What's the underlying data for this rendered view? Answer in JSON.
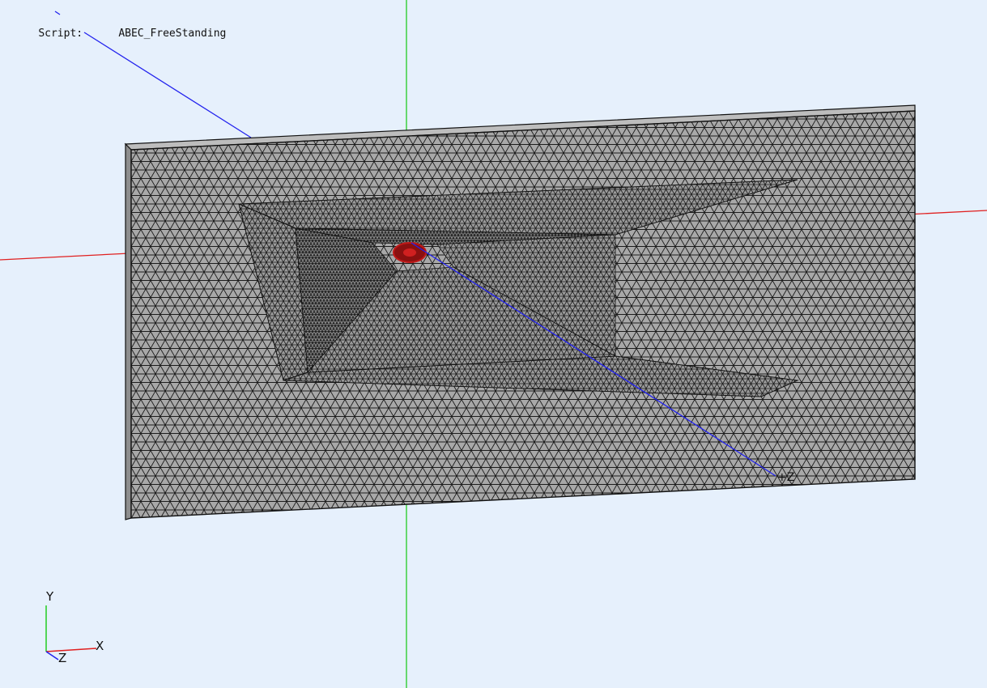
{
  "viewport": {
    "script_label": "Script:",
    "script_value": "ABEC_FreeStanding"
  },
  "axes": {
    "world_z_end_label": "+Z",
    "triad_y": "Y",
    "triad_x": "X",
    "triad_z": "Z"
  },
  "colors": {
    "background": "#e6f0fc",
    "mesh_fill": "#a8a8a8",
    "mesh_lines": "#1a1a1a",
    "x_axis": "#e02020",
    "y_axis": "#22cc22",
    "z_axis": "#2222ee",
    "driver_marker": "#c01818"
  }
}
